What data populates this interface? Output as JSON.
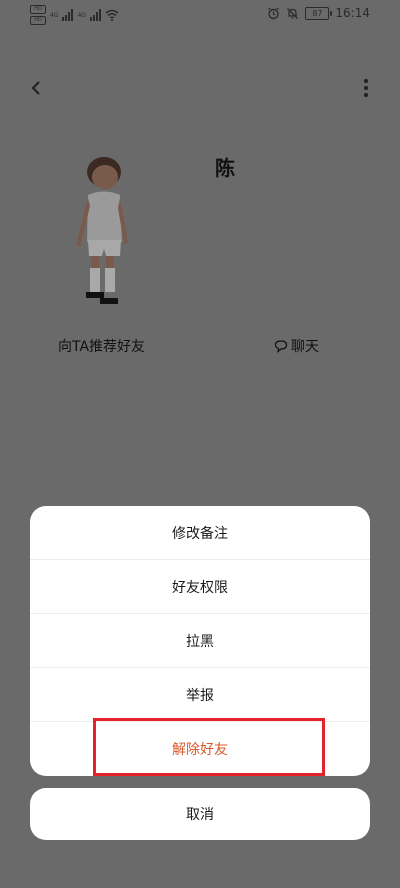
{
  "status_bar": {
    "time": "16:14",
    "battery": "87",
    "hd_labels": [
      "HD",
      "HD"
    ],
    "net_labels": [
      "4G",
      "4G"
    ]
  },
  "profile": {
    "name": "陈",
    "recommend_label": "向TA推荐好友",
    "chat_label": "聊天"
  },
  "sheet": {
    "items": [
      {
        "label": "修改备注"
      },
      {
        "label": "好友权限"
      },
      {
        "label": "拉黑"
      },
      {
        "label": "举报"
      },
      {
        "label": "解除好友"
      }
    ],
    "cancel_label": "取消"
  },
  "colors": {
    "danger": "#d9582b",
    "highlight": "#e3222a",
    "overlay": "#6a6a6a"
  }
}
